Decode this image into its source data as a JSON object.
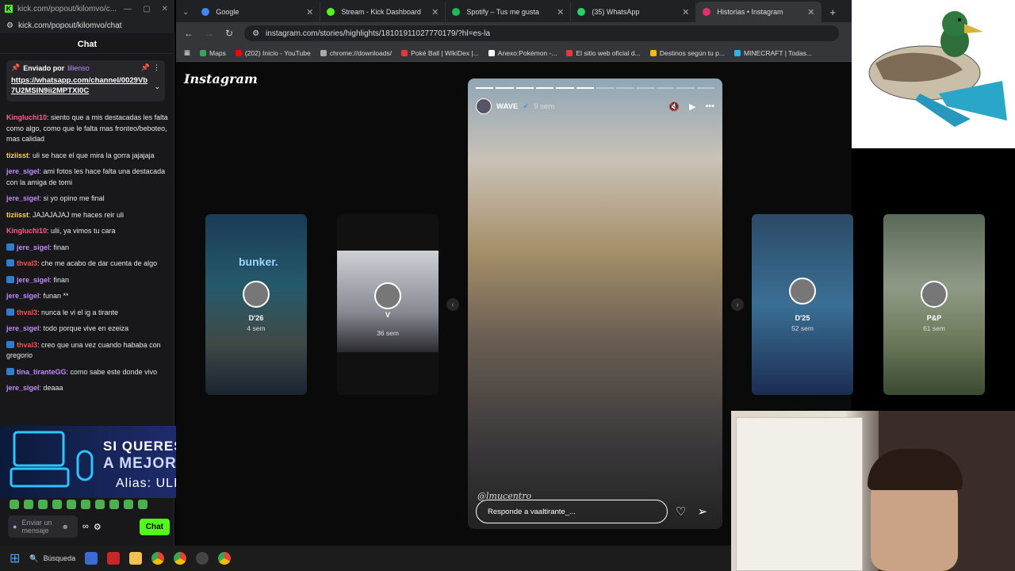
{
  "kick": {
    "window_title": "kick.com/popout/kilomvo/c...",
    "url": "kick.com/popout/kilomvo/chat",
    "chat_header": "Chat",
    "pinned": {
      "sent_by": "Enviado por",
      "sender": "lilienso",
      "link": "https://whatsapp.com/channel/0029Vb7U2MSIN9ii2MPTXI0C"
    },
    "messages": [
      {
        "user": "Kingluchi10",
        "color": "#ff5e8c",
        "badge": false,
        "text": ": siento que a mis destacadas les falta como algo, como que le falta mas fronteo/beboteo, mas calidad"
      },
      {
        "user": "tiziisst",
        "color": "#ffd36b",
        "badge": false,
        "text": ": uli se hace el que mira la gorra jajajaja"
      },
      {
        "user": "jere_sigel",
        "color": "#c18cff",
        "badge": false,
        "text": ": ami fotos les hace falta una destacada con la amiga de tomi"
      },
      {
        "user": "jere_sigel",
        "color": "#c18cff",
        "badge": false,
        "text": ": si yo opino me final"
      },
      {
        "user": "tiziisst",
        "color": "#ffd36b",
        "badge": false,
        "text": ": JAJAJAJAJ me haces reir uli"
      },
      {
        "user": "Kingluchi10",
        "color": "#ff5e8c",
        "badge": false,
        "text": ": ulii, ya vimos tu cara"
      },
      {
        "user": "jere_sigel",
        "color": "#c18cff",
        "badge": true,
        "text": ": finan"
      },
      {
        "user": "thval3",
        "color": "#ff4d4d",
        "badge": true,
        "text": ": che me acabo de dar cuenta de algo"
      },
      {
        "user": "jere_sigel",
        "color": "#c18cff",
        "badge": true,
        "text": ": finan"
      },
      {
        "user": "jere_sigel",
        "color": "#c18cff",
        "badge": false,
        "text": ": funan **"
      },
      {
        "user": "thval3",
        "color": "#ff4d4d",
        "badge": true,
        "text": ": nunca le vi el ig a tirante"
      },
      {
        "user": "jere_sigel",
        "color": "#c18cff",
        "badge": false,
        "text": ": todo porque vive en ezeiza"
      },
      {
        "user": "thval3",
        "color": "#ff4d4d",
        "badge": true,
        "text": ": creo que una vez cuando hababa con gregorio"
      },
      {
        "user": "tina_tiranteGG",
        "color": "#c18cff",
        "badge": true,
        "text": ": como sabe este donde vivo"
      },
      {
        "user": "jere_sigel",
        "color": "#c18cff",
        "badge": false,
        "text": ": deaaa"
      }
    ],
    "input_placeholder": "Enviar un mensaje",
    "chat_button": "Chat"
  },
  "banner": {
    "line1": "SI QUERES AYUDARME",
    "line2": "A MEJORAR MI PC",
    "line3": "Alias: ULISES.KLV"
  },
  "browser": {
    "tabs": [
      {
        "title": "Google",
        "color": "#4285f4",
        "active": false
      },
      {
        "title": "Stream - Kick Dashboard",
        "color": "#53fc18",
        "active": false
      },
      {
        "title": "Spotify – Tus me gusta",
        "color": "#1db954",
        "active": false
      },
      {
        "title": "(35) WhatsApp",
        "color": "#25d366",
        "active": false
      },
      {
        "title": "Historias • Instagram",
        "color": "#e1306c",
        "active": true
      }
    ],
    "url": "instagram.com/stories/highlights/18101911027770179/?hl=es-la",
    "bookmarks": [
      {
        "label": "Maps",
        "color": "#34a853"
      },
      {
        "label": "(202) Inicio - YouTube",
        "color": "#ff0000"
      },
      {
        "label": "chrome://downloads/",
        "color": "#aaaaaa"
      },
      {
        "label": "Poké Ball | WikiDex |...",
        "color": "#e53935"
      },
      {
        "label": "Anexo:Pokémon -...",
        "color": "#ffffff"
      },
      {
        "label": "El sitio web oficial d...",
        "color": "#e53935"
      },
      {
        "label": "Destinos según tu p...",
        "color": "#fbbc05"
      },
      {
        "label": "MINECRAFT | Todas...",
        "color": "#29b6f6"
      }
    ]
  },
  "instagram": {
    "logo": "Instagram",
    "thumbs": [
      {
        "title": "D'26",
        "ago": "4 sem"
      },
      {
        "title": "V",
        "ago": "36 sem"
      },
      {
        "title": "D'25",
        "ago": "52 sem"
      },
      {
        "title": "P&P",
        "ago": "61 sem"
      }
    ],
    "story": {
      "user": "WAVE",
      "ago": "9 sem",
      "watermark": "@lmucentro",
      "reply_placeholder": "Responde a vaaltirante_...",
      "progress_done": 6,
      "progress_total": 12
    },
    "thumb_overlay_texts": [
      "bunker."
    ]
  },
  "taskbar": {
    "search_label": "Búsqueda"
  }
}
